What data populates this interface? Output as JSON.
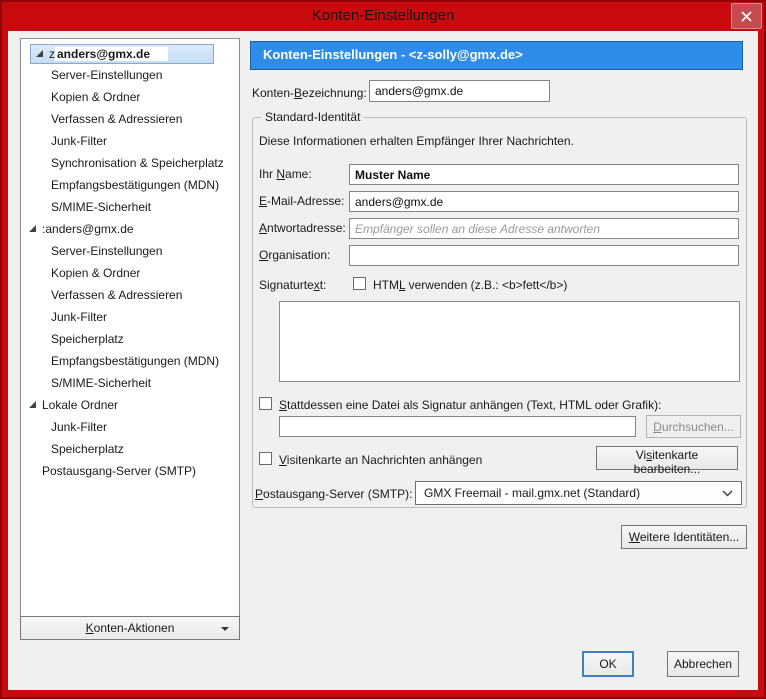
{
  "window": {
    "title": "Konten-Einstellungen"
  },
  "colors": {
    "frame_red": "#c90b0f",
    "header_blue": "#2e8de8",
    "selection_blue": "#cfe3f6",
    "dialog_bg": "#f0f0f0"
  },
  "sidebar": {
    "items": [
      {
        "label": "anders@gmx.de",
        "remnant": "z",
        "level": 0,
        "expanded": true,
        "selected": true
      },
      {
        "label": "Server-Einstellungen",
        "level": 1
      },
      {
        "label": "Kopien & Ordner",
        "level": 1
      },
      {
        "label": "Verfassen & Adressieren",
        "level": 1
      },
      {
        "label": "Junk-Filter",
        "level": 1
      },
      {
        "label": "Synchronisation & Speicherplatz",
        "level": 1
      },
      {
        "label": "Empfangsbestätigungen (MDN)",
        "level": 1
      },
      {
        "label": "S/MIME-Sicherheit",
        "level": 1
      },
      {
        "label": "anders@gmx.de",
        "remnant": ":",
        "level": 0,
        "expanded": true
      },
      {
        "label": "Server-Einstellungen",
        "level": 1
      },
      {
        "label": "Kopien & Ordner",
        "level": 1
      },
      {
        "label": "Verfassen & Adressieren",
        "level": 1
      },
      {
        "label": "Junk-Filter",
        "level": 1
      },
      {
        "label": "Speicherplatz",
        "level": 1
      },
      {
        "label": "Empfangsbestätigungen (MDN)",
        "level": 1
      },
      {
        "label": "S/MIME-Sicherheit",
        "level": 1
      },
      {
        "label": "Lokale Ordner",
        "level": 0,
        "expanded": true
      },
      {
        "label": "Junk-Filter",
        "level": 1
      },
      {
        "label": "Speicherplatz",
        "level": 1
      },
      {
        "label": "Postausgang-Server (SMTP)",
        "level": 0
      }
    ],
    "actions_button": "Konten-Aktionen"
  },
  "main": {
    "header": "Konten-Einstellungen - <z-solly@gmx.de>",
    "account_name": {
      "label": "Konten-Bezeichnung:",
      "value": "anders@gmx.de"
    },
    "identity": {
      "legend": "Standard-Identität",
      "info": "Diese Informationen erhalten Empfänger Ihrer Nachrichten.",
      "fields": {
        "name": {
          "label": "Ihr Name:",
          "value": "Muster Name"
        },
        "email": {
          "label": "E-Mail-Adresse:",
          "value": "anders@gmx.de"
        },
        "reply": {
          "label": "Antwortadresse:",
          "placeholder": "Empfänger sollen an diese Adresse antworten"
        },
        "org": {
          "label": "Organisation:",
          "value": ""
        }
      },
      "signature": {
        "label": "Signaturtext:",
        "html_checkbox_label": "HTML verwenden (z.B.: <b>fett</b>)"
      },
      "attach_file": {
        "label": "Stattdessen eine Datei als Signatur anhängen (Text, HTML oder Grafik):",
        "path_value": "",
        "browse_button": "Durchsuchen..."
      },
      "vcard": {
        "label": "Visitenkarte an Nachrichten anhängen",
        "edit_button": "Visitenkarte bearbeiten..."
      },
      "smtp": {
        "label": "Postausgang-Server (SMTP):",
        "value": "GMX Freemail - mail.gmx.net (Standard)"
      }
    },
    "more_identities_button": "Weitere Identitäten..."
  },
  "footer": {
    "ok": "OK",
    "cancel": "Abbrechen"
  }
}
